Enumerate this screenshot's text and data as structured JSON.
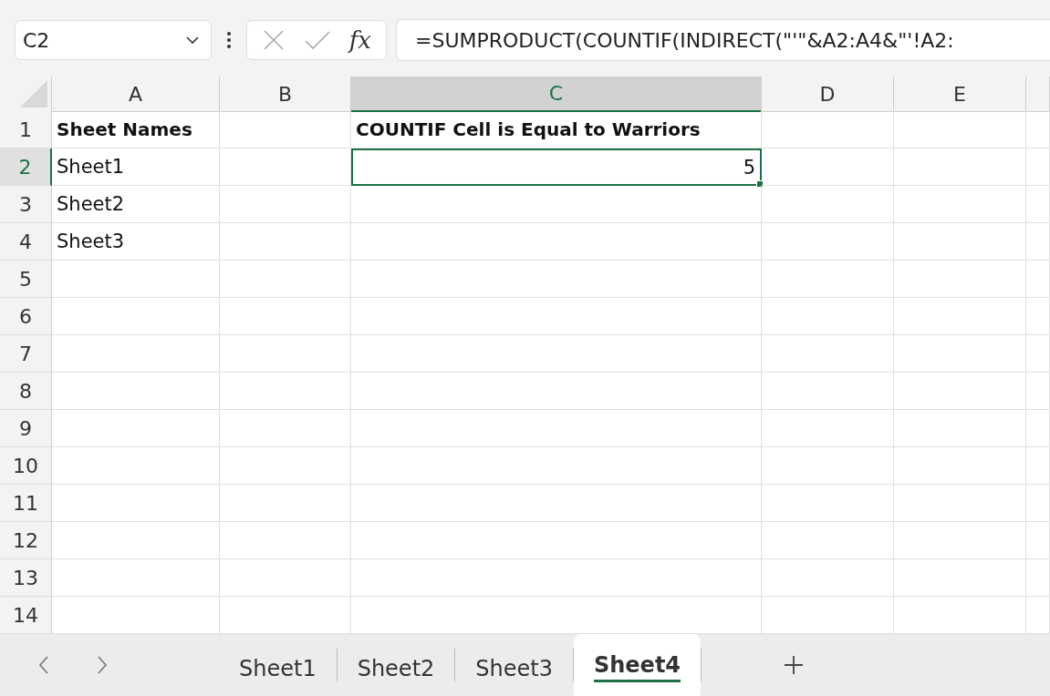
{
  "name_box": {
    "value": "C2"
  },
  "formula_bar": {
    "function_label": "fx",
    "value": "=SUMPRODUCT(COUNTIF(INDIRECT(\"'\"&A2:A4&\"'!A2:"
  },
  "columns": [
    {
      "label": "A",
      "selected": false
    },
    {
      "label": "B",
      "selected": false
    },
    {
      "label": "C",
      "selected": true
    },
    {
      "label": "D",
      "selected": false
    },
    {
      "label": "E",
      "selected": false
    }
  ],
  "rows": [
    {
      "label": "1",
      "selected": false,
      "cells": {
        "A": {
          "text": "Sheet Names",
          "bold": true,
          "kind": "text",
          "selected": false
        },
        "C": {
          "text": "COUNTIF Cell is Equal to Warriors",
          "bold": true,
          "kind": "text",
          "selected": false
        }
      }
    },
    {
      "label": "2",
      "selected": true,
      "cells": {
        "A": {
          "text": "Sheet1",
          "bold": false,
          "kind": "text",
          "selected": false
        },
        "C": {
          "text": "5",
          "bold": false,
          "kind": "number",
          "selected": true
        }
      }
    },
    {
      "label": "3",
      "selected": false,
      "cells": {
        "A": {
          "text": "Sheet2",
          "bold": false,
          "kind": "text",
          "selected": false
        }
      }
    },
    {
      "label": "4",
      "selected": false,
      "cells": {
        "A": {
          "text": "Sheet3",
          "bold": false,
          "kind": "text",
          "selected": false
        }
      }
    },
    {
      "label": "5",
      "selected": false
    },
    {
      "label": "6",
      "selected": false
    },
    {
      "label": "7",
      "selected": false
    },
    {
      "label": "8",
      "selected": false
    },
    {
      "label": "9",
      "selected": false
    },
    {
      "label": "10",
      "selected": false
    },
    {
      "label": "11",
      "selected": false
    },
    {
      "label": "12",
      "selected": false
    },
    {
      "label": "13",
      "selected": false
    },
    {
      "label": "14",
      "selected": false
    }
  ],
  "sheet_tabs": [
    {
      "label": "Sheet1",
      "selected": false
    },
    {
      "label": "Sheet2",
      "selected": false
    },
    {
      "label": "Sheet3",
      "selected": false
    },
    {
      "label": "Sheet4",
      "selected": true
    }
  ]
}
